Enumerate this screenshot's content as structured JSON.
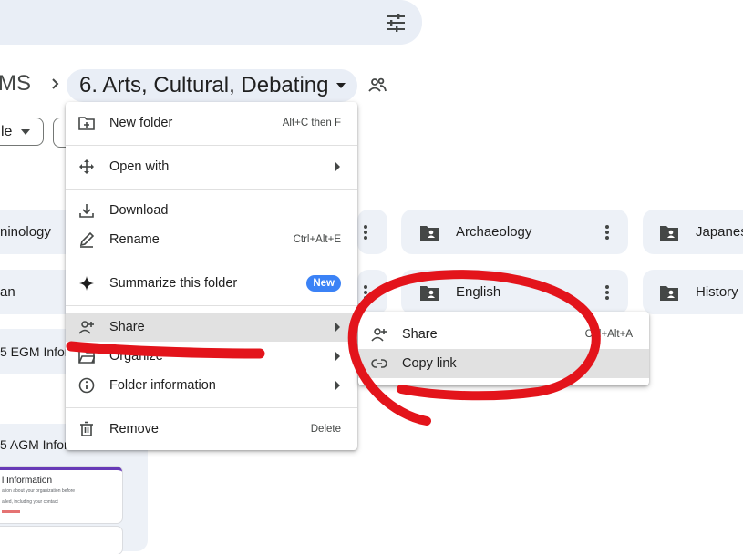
{
  "header": {
    "filter_icon": "tune-icon"
  },
  "breadcrumb": {
    "root": "MS",
    "current": "6. Arts, Cultural, Debating"
  },
  "filters": {
    "chip1_label": "le"
  },
  "folders": [
    {
      "name": "ninology"
    },
    {
      "name": "Archaeology"
    },
    {
      "name": "Japanes"
    },
    {
      "name": "an"
    },
    {
      "name": "English"
    },
    {
      "name": "History"
    }
  ],
  "files": [
    {
      "name": "5 EGM Infor"
    },
    {
      "name": "5 AGM Infor"
    }
  ],
  "preview": {
    "title": "l Information",
    "line1": "ation about your organization before",
    "line2": "ailed, including your contact"
  },
  "context_menu": {
    "items": [
      {
        "label": "New folder",
        "shortcut": "Alt+C then F",
        "icon": "folder-add-icon"
      },
      {
        "label": "Open with",
        "icon": "move-arrows-icon"
      },
      {
        "label": "Download",
        "icon": "download-icon"
      },
      {
        "label": "Rename",
        "shortcut": "Ctrl+Alt+E",
        "icon": "pencil-icon"
      },
      {
        "label": "Summarize this folder",
        "badge": "New",
        "icon": "sparkle-icon"
      },
      {
        "label": "Share",
        "icon": "person-add-icon"
      },
      {
        "label": "Organize",
        "icon": "folder-open-icon"
      },
      {
        "label": "Folder information",
        "icon": "info-icon"
      },
      {
        "label": "Remove",
        "shortcut": "Delete",
        "icon": "trash-icon"
      }
    ]
  },
  "share_submenu": {
    "items": [
      {
        "label": "Share",
        "shortcut": "Ctrl+Alt+A",
        "icon": "person-add-icon"
      },
      {
        "label": "Copy link",
        "icon": "link-icon"
      }
    ]
  },
  "colors": {
    "annotation": "#e3141b",
    "accent_badge": "#3b82f6",
    "highlight": "#e1e1e1"
  }
}
